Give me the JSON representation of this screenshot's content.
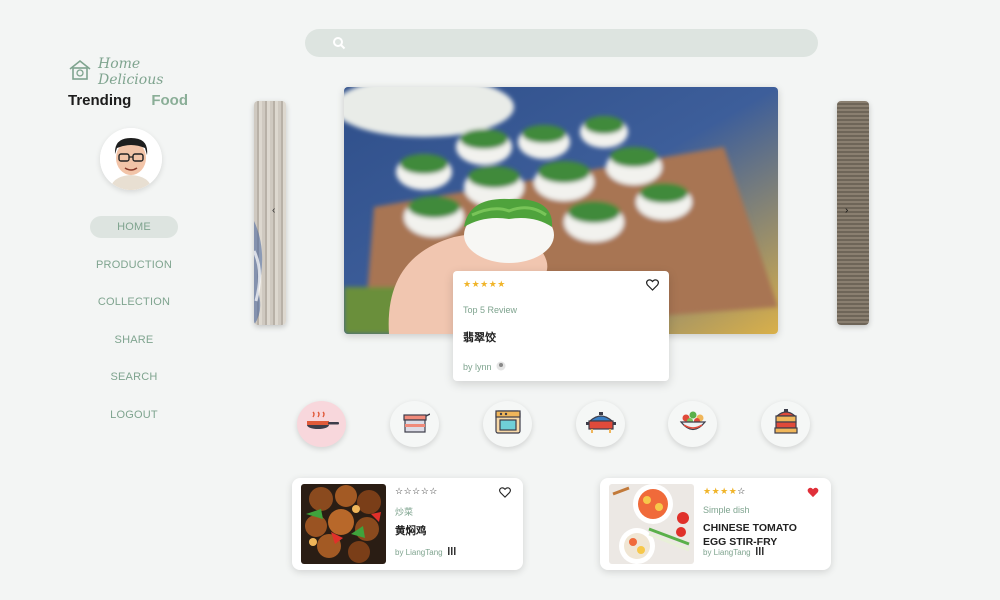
{
  "brand": {
    "name": "Home Delicious",
    "tagline_left": "Trending",
    "tagline_right": "Food"
  },
  "sidebar": {
    "items": [
      {
        "label": "HOME",
        "active": true
      },
      {
        "label": "PRODUCTION",
        "active": false
      },
      {
        "label": "COLLECTION",
        "active": false
      },
      {
        "label": "SHARE",
        "active": false
      },
      {
        "label": "SEARCH",
        "active": false
      },
      {
        "label": "LOGOUT",
        "active": false
      }
    ]
  },
  "search": {
    "placeholder": ""
  },
  "featured": {
    "stars": "★★★★★",
    "tag": "Top 5 Review",
    "title": "翡翠饺",
    "author": "by lynn"
  },
  "categories": [
    {
      "icon": "frying-pan-icon",
      "active": true
    },
    {
      "icon": "pot-icon",
      "active": false
    },
    {
      "icon": "oven-icon",
      "active": false
    },
    {
      "icon": "wok-icon",
      "active": false
    },
    {
      "icon": "salad-bowl-icon",
      "active": false
    },
    {
      "icon": "steamer-icon",
      "active": false
    }
  ],
  "recipes": [
    {
      "stars_on": "",
      "stars_off": "☆☆☆☆☆",
      "tag": "炒菜",
      "title": "黄焖鸡",
      "author": "by LiangTang",
      "liked": false
    },
    {
      "stars_on": "★★★★",
      "stars_off": "☆",
      "tag": "Simple dish",
      "title": "CHINESE TOMATO EGG STIR-FRY",
      "author": "by LiangTang",
      "liked": true
    }
  ],
  "colors": {
    "accent": "#7fa48f",
    "active_bg": "#dde4e0",
    "star": "#f0b429",
    "like": "#e0303a",
    "category_active": "#f8d7dc"
  }
}
